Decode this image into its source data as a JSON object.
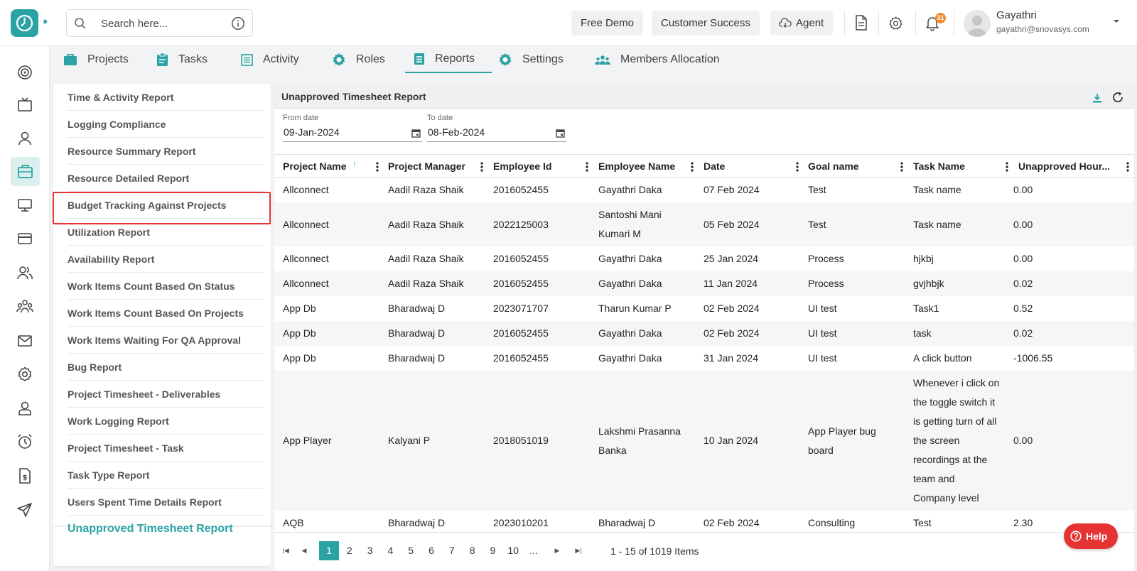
{
  "header": {
    "search_placeholder": "Search here...",
    "buttons": [
      "Free Demo",
      "Customer Success",
      "Agent"
    ],
    "notification_count": "31",
    "user": {
      "name": "Gayathri",
      "email": "gayathri@snovasys.com"
    }
  },
  "tabs": [
    "Projects",
    "Tasks",
    "Activity",
    "Roles",
    "Reports",
    "Settings",
    "Members Allocation"
  ],
  "active_tab": "Reports",
  "reports": [
    "Time & Activity Report",
    "Logging Compliance",
    "Resource Summary Report",
    "Resource Detailed Report",
    "Budget Tracking Against Projects",
    "Utilization Report",
    "Availability Report",
    "Work Items Count Based On Status",
    "Work Items Count Based On Projects",
    "Work Items Waiting For QA Approval",
    "Bug Report",
    "Project Timesheet - Deliverables",
    "Work Logging Report",
    "Project Timesheet - Task",
    "Task Type Report",
    "Users Spent Time Details Report",
    "Unapproved Timesheet Report"
  ],
  "report": {
    "title": "Unapproved Timesheet Report",
    "from_label": "From date",
    "from_value": "09-Jan-2024",
    "to_label": "To date",
    "to_value": "08-Feb-2024"
  },
  "table": {
    "columns": [
      "Project Name",
      "Project Manager",
      "Employee Id",
      "Employee Name",
      "Date",
      "Goal name",
      "Task Name",
      "Unapproved Hour..."
    ],
    "rows": [
      [
        "Allconnect",
        "Aadil Raza Shaik",
        "2016052455",
        "Gayathri Daka",
        "07 Feb 2024",
        "Test",
        "Task name",
        "0.00"
      ],
      [
        "Allconnect",
        "Aadil Raza Shaik",
        "2022125003",
        "Santoshi Mani\nKumari M",
        "05 Feb 2024",
        "Test",
        "Task name",
        "0.00"
      ],
      [
        "Allconnect",
        "Aadil Raza Shaik",
        "2016052455",
        "Gayathri Daka",
        "25 Jan 2024",
        "Process",
        "hjkbj",
        "0.00"
      ],
      [
        "Allconnect",
        "Aadil Raza Shaik",
        "2016052455",
        "Gayathri Daka",
        "11 Jan 2024",
        "Process",
        "gvjhbjk",
        "0.02"
      ],
      [
        "App Db",
        "Bharadwaj D",
        "2023071707",
        "Tharun Kumar P",
        "02 Feb 2024",
        "UI test",
        "Task1",
        "0.52"
      ],
      [
        "App Db",
        "Bharadwaj D",
        "2016052455",
        "Gayathri Daka",
        "02 Feb 2024",
        "UI test",
        "task",
        "0.02"
      ],
      [
        "App Db",
        "Bharadwaj D",
        "2016052455",
        "Gayathri Daka",
        "31 Jan 2024",
        "UI test",
        "A click button",
        "-1006.55"
      ],
      [
        "App Player",
        "Kalyani P",
        "2018051019",
        "Lakshmi Prasanna\nBanka",
        "10 Jan 2024",
        "App Player bug\nboard",
        "Whenever i click on\nthe toggle switch it\nis getting turn of all\nthe screen\nrecordings at the\nteam and\nCompany level",
        "0.00"
      ],
      [
        "AQB",
        "Bharadwaj D",
        "2023010201",
        "Bharadwaj D",
        "02 Feb 2024",
        "Consulting",
        "Test",
        "2.30"
      ]
    ]
  },
  "pagination": {
    "pages": [
      "1",
      "2",
      "3",
      "4",
      "5",
      "6",
      "7",
      "8",
      "9",
      "10",
      "..."
    ],
    "current": "1",
    "info": "1 - 15 of 1019 Items"
  },
  "help_label": "Help"
}
